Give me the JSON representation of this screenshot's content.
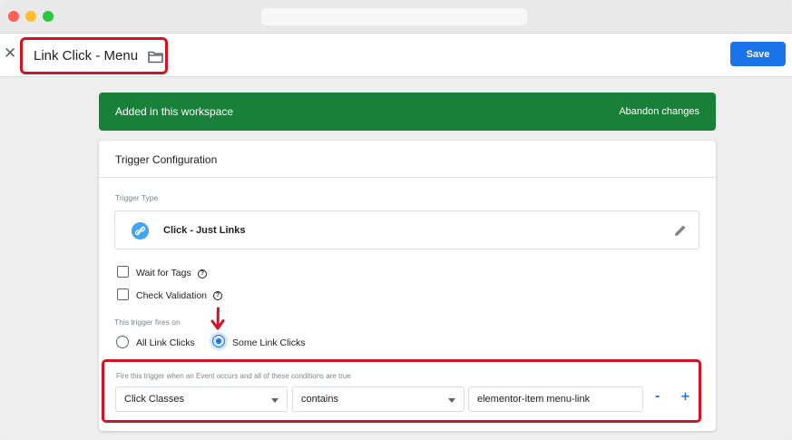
{
  "header": {
    "title": "Link Click - Menu",
    "save_label": "Save"
  },
  "banner": {
    "message": "Added in this workspace",
    "action": "Abandon changes"
  },
  "card": {
    "title": "Trigger Configuration",
    "trigger_type_label": "Trigger Type",
    "trigger_type_name": "Click - Just Links",
    "wait_for_tags_label": "Wait for Tags",
    "check_validation_label": "Check Validation",
    "fires_on_label": "This trigger fires on",
    "radio_all": "All Link Clicks",
    "radio_some": "Some Link Clicks",
    "selected_option": "Some Link Clicks"
  },
  "conditions": {
    "label": "Fire this trigger when an Event occurs and all of these conditions are true",
    "variable": "Click Classes",
    "operator": "contains",
    "value": "elementor-item menu-link",
    "remove_label": "-",
    "add_label": "+"
  },
  "colors": {
    "accent": "#1a73e8",
    "banner": "#188038",
    "highlight": "#d31324"
  }
}
